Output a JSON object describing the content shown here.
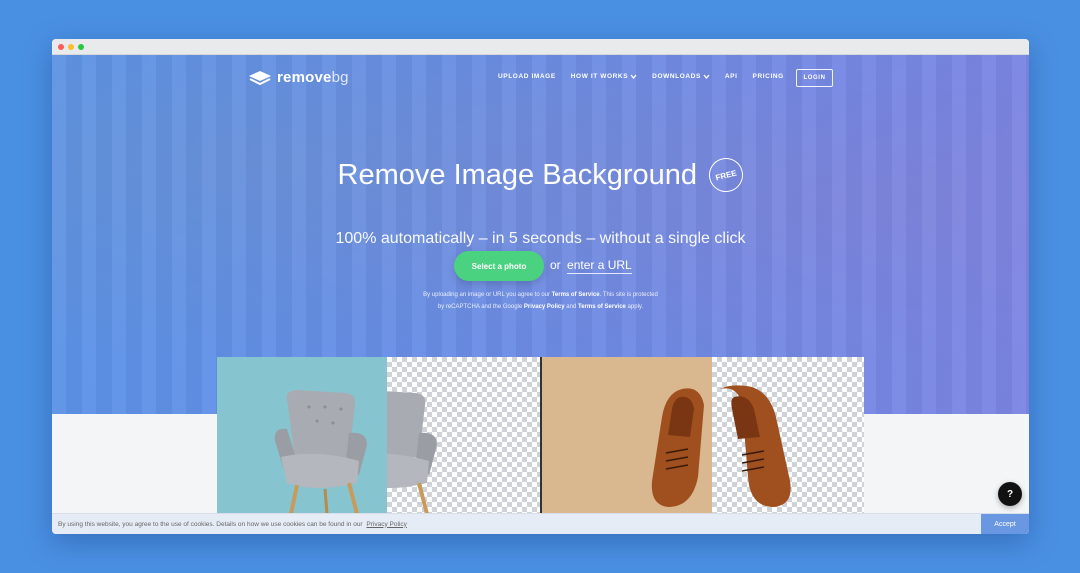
{
  "brand": {
    "name": "remove",
    "suffix": "bg"
  },
  "nav": {
    "items": [
      {
        "label": "UPLOAD IMAGE"
      },
      {
        "label": "HOW IT WORKS"
      },
      {
        "label": "DOWNLOADS"
      },
      {
        "label": "API"
      },
      {
        "label": "PRICING"
      }
    ],
    "login_label": "LOGIN"
  },
  "hero": {
    "title": "Remove Image Background",
    "badge": "FREE",
    "subtitle": "100% automatically – in 5 seconds – without a single click",
    "select_button": "Select a photo",
    "or_text": "or",
    "url_link": "enter a URL",
    "legal": {
      "p1": "By uploading an image or URL you agree to our",
      "tos": "Terms of Service",
      "p2": ". This site is protected",
      "p3": "by reCAPTCHA and the Google",
      "privacy": "Privacy Policy",
      "p4": "and",
      "tos2": "Terms of Service",
      "p5": "apply."
    }
  },
  "cookie": {
    "text": "By using this website, you agree to the use of cookies. Details on how we use cookies can be found in our",
    "link": "Privacy Policy",
    "accept": "Accept"
  },
  "help": {
    "label": "?"
  },
  "colors": {
    "page_bg": "#4a90e2",
    "accent_green": "#4bd280",
    "hero_left": "#5b95e8",
    "hero_right": "#7d86e4",
    "accept_bg": "#6a97e2",
    "chair_bg": "#86c5cf",
    "wood_bg": "#d9b88f"
  }
}
